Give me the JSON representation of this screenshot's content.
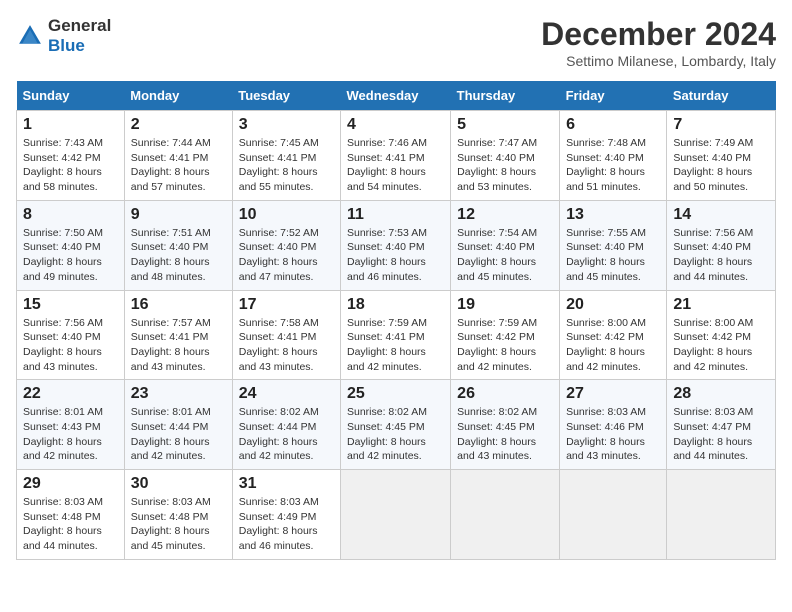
{
  "header": {
    "logo_line1": "General",
    "logo_line2": "Blue",
    "month_title": "December 2024",
    "location": "Settimo Milanese, Lombardy, Italy"
  },
  "days_of_week": [
    "Sunday",
    "Monday",
    "Tuesday",
    "Wednesday",
    "Thursday",
    "Friday",
    "Saturday"
  ],
  "weeks": [
    [
      {
        "day": "1",
        "sunrise": "7:43 AM",
        "sunset": "4:42 PM",
        "daylight": "8 hours and 58 minutes."
      },
      {
        "day": "2",
        "sunrise": "7:44 AM",
        "sunset": "4:41 PM",
        "daylight": "8 hours and 57 minutes."
      },
      {
        "day": "3",
        "sunrise": "7:45 AM",
        "sunset": "4:41 PM",
        "daylight": "8 hours and 55 minutes."
      },
      {
        "day": "4",
        "sunrise": "7:46 AM",
        "sunset": "4:41 PM",
        "daylight": "8 hours and 54 minutes."
      },
      {
        "day": "5",
        "sunrise": "7:47 AM",
        "sunset": "4:40 PM",
        "daylight": "8 hours and 53 minutes."
      },
      {
        "day": "6",
        "sunrise": "7:48 AM",
        "sunset": "4:40 PM",
        "daylight": "8 hours and 51 minutes."
      },
      {
        "day": "7",
        "sunrise": "7:49 AM",
        "sunset": "4:40 PM",
        "daylight": "8 hours and 50 minutes."
      }
    ],
    [
      {
        "day": "8",
        "sunrise": "7:50 AM",
        "sunset": "4:40 PM",
        "daylight": "8 hours and 49 minutes."
      },
      {
        "day": "9",
        "sunrise": "7:51 AM",
        "sunset": "4:40 PM",
        "daylight": "8 hours and 48 minutes."
      },
      {
        "day": "10",
        "sunrise": "7:52 AM",
        "sunset": "4:40 PM",
        "daylight": "8 hours and 47 minutes."
      },
      {
        "day": "11",
        "sunrise": "7:53 AM",
        "sunset": "4:40 PM",
        "daylight": "8 hours and 46 minutes."
      },
      {
        "day": "12",
        "sunrise": "7:54 AM",
        "sunset": "4:40 PM",
        "daylight": "8 hours and 45 minutes."
      },
      {
        "day": "13",
        "sunrise": "7:55 AM",
        "sunset": "4:40 PM",
        "daylight": "8 hours and 45 minutes."
      },
      {
        "day": "14",
        "sunrise": "7:56 AM",
        "sunset": "4:40 PM",
        "daylight": "8 hours and 44 minutes."
      }
    ],
    [
      {
        "day": "15",
        "sunrise": "7:56 AM",
        "sunset": "4:40 PM",
        "daylight": "8 hours and 43 minutes."
      },
      {
        "day": "16",
        "sunrise": "7:57 AM",
        "sunset": "4:41 PM",
        "daylight": "8 hours and 43 minutes."
      },
      {
        "day": "17",
        "sunrise": "7:58 AM",
        "sunset": "4:41 PM",
        "daylight": "8 hours and 43 minutes."
      },
      {
        "day": "18",
        "sunrise": "7:59 AM",
        "sunset": "4:41 PM",
        "daylight": "8 hours and 42 minutes."
      },
      {
        "day": "19",
        "sunrise": "7:59 AM",
        "sunset": "4:42 PM",
        "daylight": "8 hours and 42 minutes."
      },
      {
        "day": "20",
        "sunrise": "8:00 AM",
        "sunset": "4:42 PM",
        "daylight": "8 hours and 42 minutes."
      },
      {
        "day": "21",
        "sunrise": "8:00 AM",
        "sunset": "4:42 PM",
        "daylight": "8 hours and 42 minutes."
      }
    ],
    [
      {
        "day": "22",
        "sunrise": "8:01 AM",
        "sunset": "4:43 PM",
        "daylight": "8 hours and 42 minutes."
      },
      {
        "day": "23",
        "sunrise": "8:01 AM",
        "sunset": "4:44 PM",
        "daylight": "8 hours and 42 minutes."
      },
      {
        "day": "24",
        "sunrise": "8:02 AM",
        "sunset": "4:44 PM",
        "daylight": "8 hours and 42 minutes."
      },
      {
        "day": "25",
        "sunrise": "8:02 AM",
        "sunset": "4:45 PM",
        "daylight": "8 hours and 42 minutes."
      },
      {
        "day": "26",
        "sunrise": "8:02 AM",
        "sunset": "4:45 PM",
        "daylight": "8 hours and 43 minutes."
      },
      {
        "day": "27",
        "sunrise": "8:03 AM",
        "sunset": "4:46 PM",
        "daylight": "8 hours and 43 minutes."
      },
      {
        "day": "28",
        "sunrise": "8:03 AM",
        "sunset": "4:47 PM",
        "daylight": "8 hours and 44 minutes."
      }
    ],
    [
      {
        "day": "29",
        "sunrise": "8:03 AM",
        "sunset": "4:48 PM",
        "daylight": "8 hours and 44 minutes."
      },
      {
        "day": "30",
        "sunrise": "8:03 AM",
        "sunset": "4:48 PM",
        "daylight": "8 hours and 45 minutes."
      },
      {
        "day": "31",
        "sunrise": "8:03 AM",
        "sunset": "4:49 PM",
        "daylight": "8 hours and 46 minutes."
      },
      null,
      null,
      null,
      null
    ]
  ]
}
